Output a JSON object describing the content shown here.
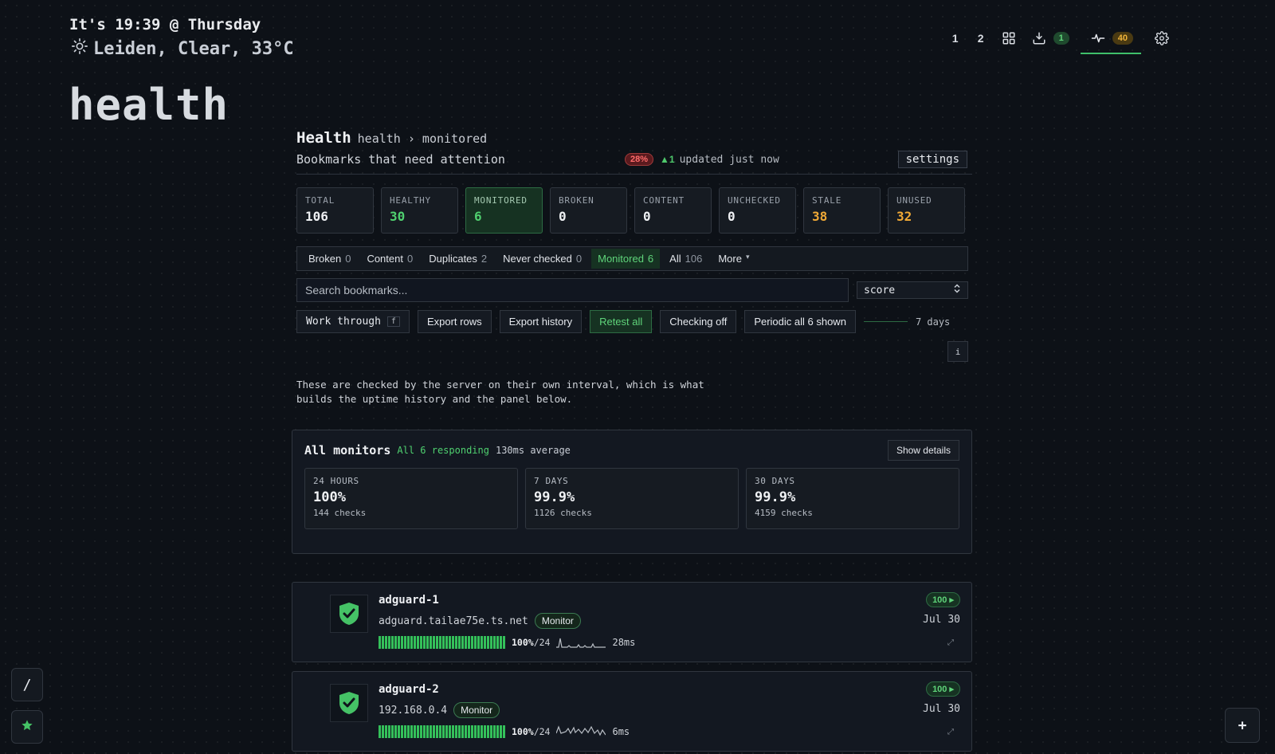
{
  "header": {
    "clock": "It's 19:39 @ Thursday",
    "weather": "Leiden, Clear, 33°C",
    "weather_icon": "sun-icon",
    "page_title": "health"
  },
  "topnav": {
    "workspace_1": "1",
    "workspace_2": "2",
    "grid_icon": "grid-icon",
    "inbox_icon": "inbox-download-icon",
    "inbox_count": "1",
    "activity_icon": "pulse-icon",
    "activity_count": "40",
    "settings_icon": "gear-icon"
  },
  "panel": {
    "title": "Health",
    "breadcrumb": "health › monitored",
    "subtitle": "Bookmarks that need attention",
    "percent_badge": "28%",
    "delta": "▲1",
    "updated": "updated just now",
    "settings_label": "settings"
  },
  "stats": [
    {
      "label": "TOTAL",
      "value": "106"
    },
    {
      "label": "HEALTHY",
      "value": "30"
    },
    {
      "label": "MONITORED",
      "value": "6"
    },
    {
      "label": "BROKEN",
      "value": "0"
    },
    {
      "label": "CONTENT",
      "value": "0"
    },
    {
      "label": "UNCHECKED",
      "value": "0"
    },
    {
      "label": "STALE",
      "value": "38"
    },
    {
      "label": "UNUSED",
      "value": "32"
    }
  ],
  "tabs": [
    {
      "label": "Broken",
      "count": "0"
    },
    {
      "label": "Content",
      "count": "0"
    },
    {
      "label": "Duplicates",
      "count": "2"
    },
    {
      "label": "Never checked",
      "count": "0"
    },
    {
      "label": "Monitored",
      "count": "6"
    },
    {
      "label": "All",
      "count": "106"
    },
    {
      "label": "More",
      "count": "▾"
    }
  ],
  "search": {
    "placeholder": "Search bookmarks...",
    "sort_value": "score"
  },
  "actions": {
    "work_through": "Work through",
    "work_through_key": "f",
    "export_rows": "Export rows",
    "export_history": "Export history",
    "retest_all": "Retest all",
    "checking_off": "Checking off",
    "periodic": "Periodic all 6 shown",
    "range": "7 days",
    "info": "i"
  },
  "description": "These are checked by the server on their own interval, which is what builds the uptime history and the panel below.",
  "monitors": {
    "title": "All monitors",
    "status": "All 6 responding",
    "average": "130ms average",
    "details_label": "Show details",
    "periods": [
      {
        "label": "24 HOURS",
        "value": "100%",
        "checks": "144 checks"
      },
      {
        "label": "7 DAYS",
        "value": "99.9%",
        "checks": "1126 checks"
      },
      {
        "label": "30 DAYS",
        "value": "99.9%",
        "checks": "4159 checks"
      }
    ]
  },
  "items": [
    {
      "name": "adguard-1",
      "host": "adguard.tailae75e.ts.net",
      "tag": "Monitor",
      "uptime_pct": "100%",
      "uptime_window": "/24",
      "latency": "28ms",
      "score": "100 ▸",
      "date": "Jul 30",
      "expand": "⤢",
      "icon": "shield-check-icon"
    },
    {
      "name": "adguard-2",
      "host": "192.168.0.4",
      "tag": "Monitor",
      "uptime_pct": "100%",
      "uptime_window": "/24",
      "latency": "6ms",
      "score": "100 ▸",
      "date": "Jul 30",
      "expand": "⤢",
      "icon": "shield-check-icon"
    }
  ],
  "sidebar": {
    "slash_label": "/",
    "star_icon": "star-icon",
    "plus_label": "+"
  },
  "colors": {
    "background": "#0d1117",
    "accent_green": "#4fd06f",
    "amber": "#f0a936",
    "danger": "#ff6b6b"
  }
}
